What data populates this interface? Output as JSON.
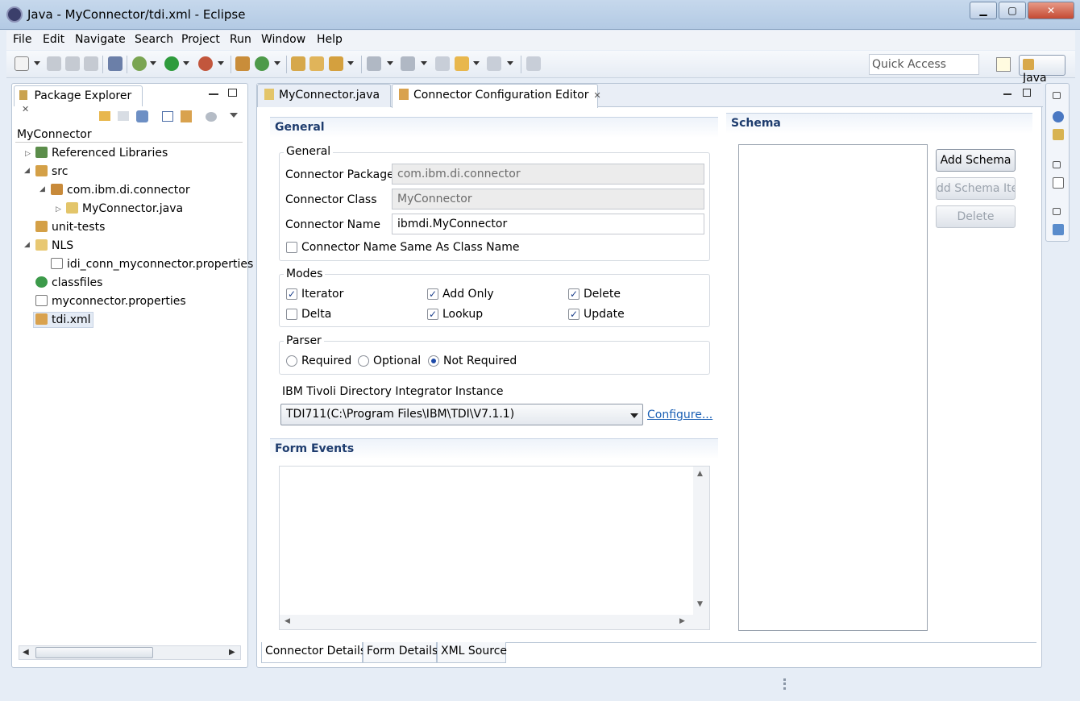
{
  "window": {
    "title": "Java - MyConnector/tdi.xml - Eclipse",
    "minimize": "▁",
    "maximize": "▢",
    "close": "✕"
  },
  "menu": [
    "File",
    "Edit",
    "Navigate",
    "Search",
    "Project",
    "Run",
    "Window",
    "Help"
  ],
  "toolbar": {
    "quick_access_placeholder": "Quick Access",
    "perspective": "Java"
  },
  "package_explorer": {
    "tab_label": "Package Explorer",
    "project": "MyConnector",
    "items": [
      {
        "label": "Referenced Libraries",
        "icon": "library-icon"
      },
      {
        "label": "src",
        "icon": "source-folder-icon"
      },
      {
        "label": "com.ibm.di.connector",
        "icon": "package-icon"
      },
      {
        "label": "MyConnector.java",
        "icon": "java-file-icon"
      },
      {
        "label": "unit-tests",
        "icon": "source-folder-icon"
      },
      {
        "label": "NLS",
        "icon": "folder-icon"
      },
      {
        "label": "idi_conn_myconnector.properties",
        "icon": "properties-file-icon"
      },
      {
        "label": "classfiles",
        "icon": "class-folder-icon"
      },
      {
        "label": "myconnector.properties",
        "icon": "properties-file-icon"
      },
      {
        "label": "tdi.xml",
        "icon": "xml-editor-icon"
      }
    ]
  },
  "editor_tabs": [
    {
      "label": "MyConnector.java"
    },
    {
      "label": "Connector Configuration Editor"
    }
  ],
  "general_section": {
    "title": "General",
    "group_label": "General",
    "package_label": "Connector Package",
    "package_value": "com.ibm.di.connector",
    "class_label": "Connector Class",
    "class_value": "MyConnector",
    "name_label": "Connector Name",
    "name_value": "ibmdi.MyConnector",
    "same_name_label": "Connector Name Same As Class Name",
    "same_name_checked": false
  },
  "modes": {
    "label": "Modes",
    "items": [
      {
        "label": "Iterator",
        "checked": true
      },
      {
        "label": "Add Only",
        "checked": true
      },
      {
        "label": "Delete",
        "checked": true
      },
      {
        "label": "Delta",
        "checked": false
      },
      {
        "label": "Lookup",
        "checked": true
      },
      {
        "label": "Update",
        "checked": true
      }
    ]
  },
  "parser": {
    "label": "Parser",
    "options": [
      {
        "label": "Required"
      },
      {
        "label": "Optional"
      },
      {
        "label": "Not Required"
      }
    ],
    "selected": "Not Required"
  },
  "instance": {
    "label": "IBM Tivoli Directory Integrator Instance",
    "value": "TDI711(C:\\Program Files\\IBM\\TDI\\V7.1.1)",
    "configure_link": "Configure..."
  },
  "form_events": {
    "title": "Form Events"
  },
  "schema": {
    "title": "Schema",
    "add_schema": "Add Schema",
    "add_schema_item": "dd Schema Ite",
    "delete": "Delete"
  },
  "bottom_tabs": [
    "Connector Details",
    "Form Details",
    "XML Source"
  ]
}
